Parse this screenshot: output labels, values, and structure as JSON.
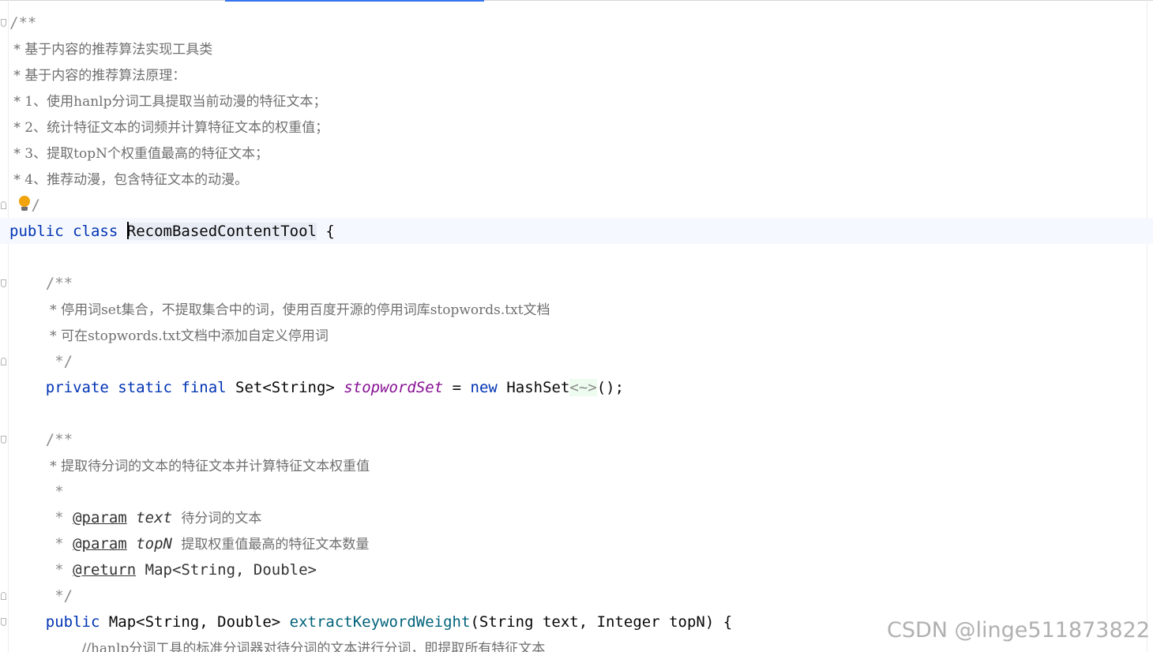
{
  "editor": {
    "class_doc": {
      "open": "/**",
      "lines": [
        " * 基于内容的推荐算法实现工具类",
        " * 基于内容的推荐算法原理：",
        " * 1、使用hanlp分词工具提取当前动漫的特征文本；",
        " * 2、统计特征文本的词频并计算特征文本的权重值；",
        " * 3、提取topN个权重值最高的特征文本；",
        " * 4、推荐动漫，包含特征文本的动漫。"
      ],
      "close": "/"
    },
    "class_decl": {
      "modifier": "public",
      "keyword": "class",
      "name": "RecomBasedContentTool",
      "brace": " {"
    },
    "field_doc": {
      "open": "/**",
      "lines": [
        " * 停用词set集合，不提取集合中的词，使用百度开源的停用词库stopwords.txt文档",
        " * 可在stopwords.txt文档中添加自定义停用词"
      ],
      "close": " */"
    },
    "field_decl": {
      "private": "private",
      "static": "static",
      "final": "final",
      "type": "Set<String>",
      "name": "stopwordSet",
      "assign": "=",
      "new": "new",
      "ctor": "HashSet",
      "diamond": "<~>",
      "tail": "();"
    },
    "method_doc": {
      "open": "/**",
      "summary": " * 提取待分词的文本的特征文本并计算特征文本权重值",
      "blank": " *",
      "star": " * ",
      "param_tag": "@param",
      "param1_name": "text",
      "param1_desc": "待分词的文本",
      "param2_name": "topN",
      "param2_desc": "提取权重值最高的特征文本数量",
      "return_tag": "@return",
      "return_desc": "Map<String, Double>",
      "close": " */"
    },
    "method_decl": {
      "modifier": "public",
      "return_type": "Map<String, Double>",
      "name": "extractKeywordWeight",
      "params": "(String text, Integer topN) {"
    },
    "body_comment": "//hanlp分词工具的标准分词器对待分词的文本进行分词，即提取所有特征文本"
  },
  "watermark": "CSDN @linge511873822",
  "colors": {
    "keyword": "#0033b3",
    "method": "#00627a",
    "field": "#871094",
    "comment": "#8c8c8c",
    "caret_line": "#f5f8fe",
    "tab_accent": "#3574f0"
  },
  "icons": {
    "intention": "bulb-icon"
  }
}
